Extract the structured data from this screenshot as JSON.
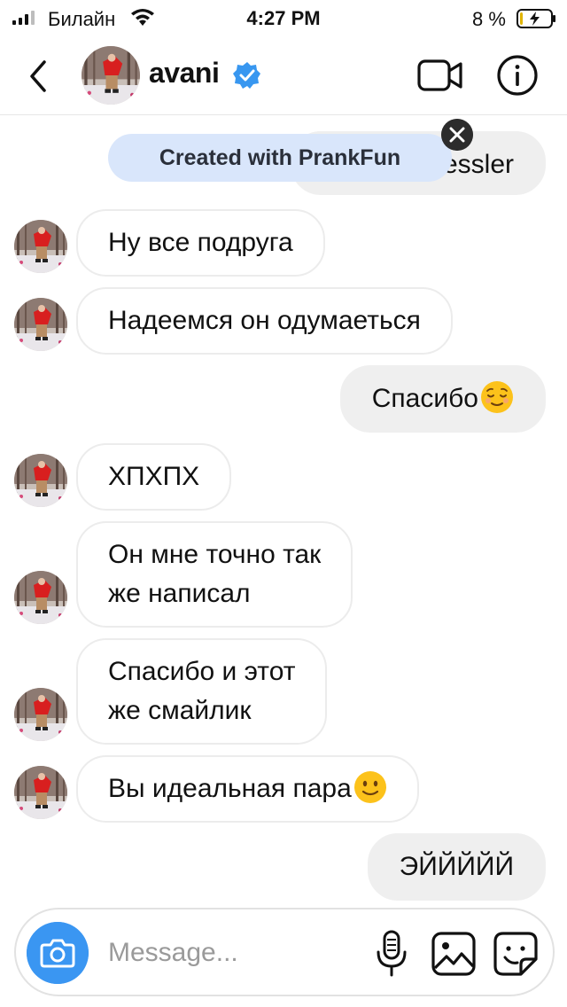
{
  "status_bar": {
    "carrier": "Билайн",
    "time": "4:27 PM",
    "battery_percent": "8 %",
    "signal_bars_filled": 3,
    "signal_bars_total": 4,
    "battery_level": 0.08,
    "charging": true
  },
  "header": {
    "username": "avani",
    "verified": true,
    "accent_color": "#3897f0"
  },
  "banner": {
    "text": "Created with PrankFun"
  },
  "messages": [
    {
      "side": "out",
      "text": "Dressler",
      "partially_hidden": true
    },
    {
      "side": "in",
      "text": "Ну все подруга"
    },
    {
      "side": "in",
      "text": "Надеемся он одумаеться"
    },
    {
      "side": "out",
      "text": "Спасибо",
      "emoji": "relieved-face-emoji"
    },
    {
      "side": "in",
      "text": "ХПХПХ"
    },
    {
      "side": "in",
      "line1": "Он мне точно так",
      "line2": "же написал"
    },
    {
      "side": "in",
      "line1": "Спасибо и этот",
      "line2": "же смайлик"
    },
    {
      "side": "in",
      "text": "Вы идеальная пара",
      "emoji": "slightly-smiling-face-emoji"
    },
    {
      "side": "out",
      "text": "ЭЙЙЙЙЙ"
    }
  ],
  "composer": {
    "placeholder": "Message...",
    "value": "",
    "camera_color": "#3a96f2"
  },
  "icons": {
    "back": "chevron-left-icon",
    "video": "video-call-icon",
    "info": "info-icon",
    "camera": "camera-icon",
    "mic": "microphone-icon",
    "gallery": "image-icon",
    "sticker": "sticker-icon",
    "close": "close-icon"
  }
}
